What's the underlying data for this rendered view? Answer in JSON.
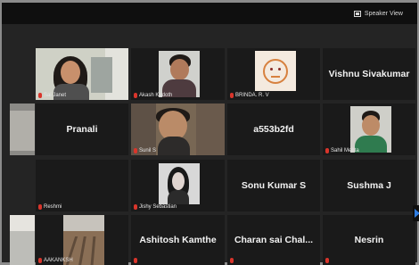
{
  "toolbar": {
    "speaker_view_label": "Speaker View"
  },
  "participants": [
    {
      "name": "Sai Janet",
      "display": "video"
    },
    {
      "name": "Akash Kudoth",
      "display": "video"
    },
    {
      "name": "BRINDA. R. V",
      "display": "avatar"
    },
    {
      "name": "Vishnu Sivakumar",
      "display": "name-only"
    },
    {
      "name": "",
      "display": "video"
    },
    {
      "name": "Pranali",
      "display": "name-only"
    },
    {
      "name": "Sunil S",
      "display": "video"
    },
    {
      "name": "a553b2fd",
      "display": "name-only"
    },
    {
      "name": "Sahil Mehta",
      "display": "video"
    },
    {
      "name": "Reshmi",
      "display": "name-only-label"
    },
    {
      "name": "Jishy Sebastian",
      "display": "video"
    },
    {
      "name": "Sonu Kumar S",
      "display": "name-only"
    },
    {
      "name": "Sushma J",
      "display": "name-only"
    },
    {
      "name": "",
      "display": "video"
    },
    {
      "name": "AAKANKSH",
      "display": "video"
    },
    {
      "name": "Ashitosh Kamthe",
      "display": "name-only"
    },
    {
      "name": "Charan sai Chal...",
      "display": "name-only"
    },
    {
      "name": "Nesrin",
      "display": "name-only"
    }
  ]
}
